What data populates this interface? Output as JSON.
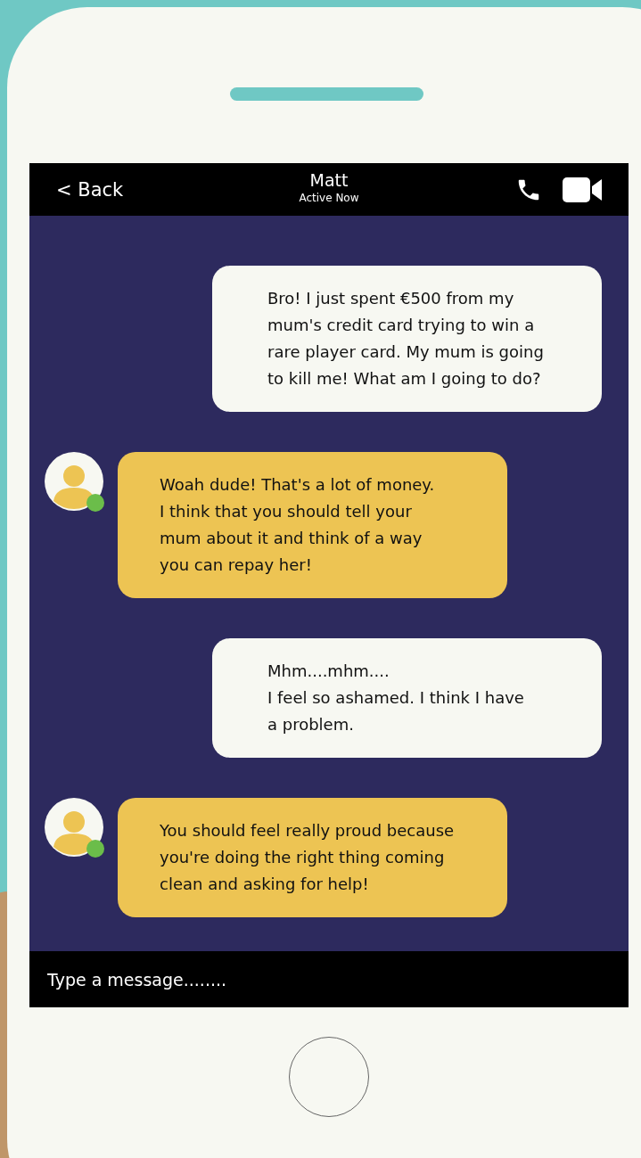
{
  "header": {
    "back": "< Back",
    "name": "Matt",
    "status": "Active Now"
  },
  "messages": [
    {
      "kind": "sent",
      "text": "Bro! I just spent €500 from my\nmum's credit card trying to win a\nrare player card. My mum is going\nto kill me! What am I going to do?"
    },
    {
      "kind": "received",
      "online": true,
      "text": "Woah dude! That's a lot of money.\nI think that you should tell your\nmum about it and think of a way\nyou can repay her!"
    },
    {
      "kind": "sent",
      "text": "Mhm....mhm....\nI feel so ashamed. I think I have\na problem."
    },
    {
      "kind": "received",
      "online": true,
      "text": "You should feel really proud because\nyou're doing the right thing coming\nclean and asking for help!"
    }
  ],
  "input": {
    "placeholder": "Type a message........"
  }
}
